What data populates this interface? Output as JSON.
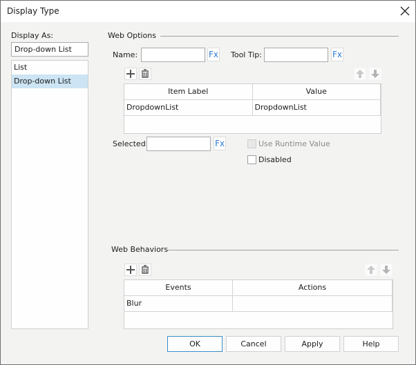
{
  "window": {
    "title": "Display Type",
    "close_icon": "close-icon"
  },
  "display_as": {
    "label": "Display As:",
    "value": "Drop-down List",
    "options": [
      {
        "label": "List",
        "selected": false
      },
      {
        "label": "Drop-down List",
        "selected": true
      }
    ]
  },
  "web_options": {
    "section_title": "Web Options",
    "name_label": "Name:",
    "name_value": "",
    "tooltip_label": "Tool Tip:",
    "tooltip_value": "",
    "fx_label": "Fx",
    "toolbar": {
      "add_icon": "plus-icon",
      "delete_icon": "trash-icon",
      "up_icon": "arrow-up-icon",
      "down_icon": "arrow-down-icon"
    },
    "table": {
      "columns": [
        "Item Label",
        "Value"
      ],
      "rows": [
        [
          "DropdownList",
          "DropdownList"
        ]
      ]
    },
    "selected_label": "Selected:",
    "selected_value": "",
    "use_runtime_value_label": "Use Runtime Value",
    "use_runtime_value_checked": false,
    "disabled_label": "Disabled",
    "disabled_checked": false
  },
  "web_behaviors": {
    "section_title": "Web Behaviors",
    "table": {
      "columns": [
        "Events",
        "Actions"
      ],
      "rows": [
        [
          "Blur",
          ""
        ]
      ]
    }
  },
  "buttons": {
    "ok": "OK",
    "cancel": "Cancel",
    "apply": "Apply",
    "help": "Help"
  },
  "colors": {
    "accent": "#3a8cc9",
    "selection": "#cce4f3",
    "fx": "#2c7cd6"
  }
}
